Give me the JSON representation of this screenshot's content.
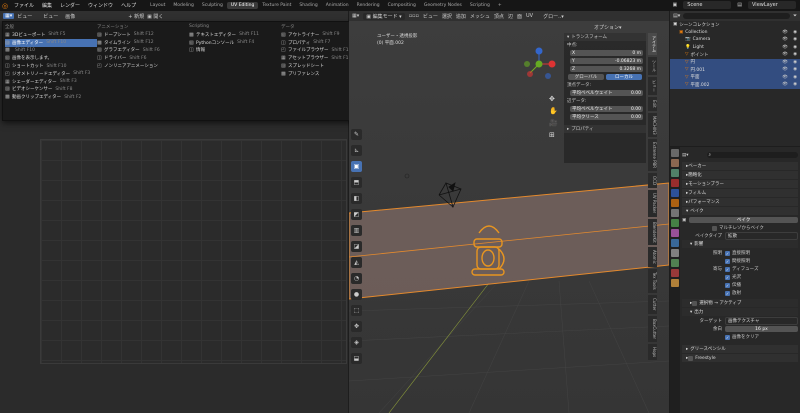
{
  "app": {
    "menus": [
      "ファイル",
      "編集",
      "レンダー",
      "ウィンドウ",
      "ヘルプ"
    ],
    "workspaces": [
      "Layout",
      "Modeling",
      "Sculpting",
      "UV Editing",
      "Texture Paint",
      "Shading",
      "Animation",
      "Rendering",
      "Compositing",
      "Geometry Nodes",
      "Scripting"
    ],
    "active_workspace": "UV Editing",
    "plus": "+",
    "scene": "Scene",
    "view_layer": "ViewLayer",
    "accent": "#e87d0d",
    "selection_blue": "#4772b3"
  },
  "left_editor": {
    "header_items": [
      "ビュー",
      "ビュー",
      "画像"
    ],
    "sub_header": [
      "新規",
      "開く"
    ]
  },
  "editor_menu": {
    "columns": [
      {
        "title": "全般",
        "items": [
          {
            "label": "3Dビューポート",
            "shortcut": "Shift F5"
          },
          {
            "label": "画像エディター",
            "shortcut": "Shift F10",
            "selected": true
          },
          {
            "label": "",
            "shortcut": "Shift F10"
          },
          {
            "label": "画像を表示します。",
            "shortcut": ""
          },
          {
            "label": "ショートカット",
            "shortcut": "Shift F10"
          },
          {
            "label": "ジオメトリノードエディター",
            "shortcut": "Shift F3"
          },
          {
            "label": "シェーダーエディター",
            "shortcut": "Shift F3"
          },
          {
            "label": "ビデオシーケンサー",
            "shortcut": "Shift F8"
          },
          {
            "label": "動画クリップエディター",
            "shortcut": "Shift F2"
          }
        ]
      },
      {
        "title": "アニメーション",
        "items": [
          {
            "label": "ドープシート",
            "shortcut": "Shift F12"
          },
          {
            "label": "タイムライン",
            "shortcut": "Shift F12"
          },
          {
            "label": "グラフエディター",
            "shortcut": "Shift F6"
          },
          {
            "label": "ドライバー",
            "shortcut": "Shift F6"
          },
          {
            "label": "ノンリニアアニメーション",
            "shortcut": ""
          }
        ]
      },
      {
        "title": "Scripting",
        "items": [
          {
            "label": "テキストエディター",
            "shortcut": "Shift F11"
          },
          {
            "label": "Pythonコンソール",
            "shortcut": "Shift F4"
          },
          {
            "label": "情報",
            "shortcut": ""
          }
        ]
      },
      {
        "title": "データ",
        "items": [
          {
            "label": "アウトライナー",
            "shortcut": "Shift F9"
          },
          {
            "label": "プロパティ",
            "shortcut": "Shift F7"
          },
          {
            "label": "ファイルブラウザー",
            "shortcut": "Shift F1"
          },
          {
            "label": "アセットブラウザー",
            "shortcut": "Shift F1"
          },
          {
            "label": "スプレッドシート",
            "shortcut": ""
          },
          {
            "label": "プリファレンス",
            "shortcut": ""
          }
        ]
      }
    ]
  },
  "viewport": {
    "mode": "編集モード",
    "menus": [
      "ビュー",
      "選択",
      "追加",
      "メッシュ",
      "頂点",
      "辺",
      "面",
      "UV"
    ],
    "transform_orientation": "グロー..",
    "options": "オプション",
    "overlay_line1": "ユーザー・透視投影",
    "overlay_line2": "(0) 平面.002",
    "npanel": {
      "title": "トランスフォーム",
      "median_label": "中点:",
      "fields": [
        {
          "axis": "X",
          "value": "0 m"
        },
        {
          "axis": "Y",
          "value": "-0.06823 m"
        },
        {
          "axis": "Z",
          "value": "0.3268 m"
        }
      ],
      "global": "グローバル",
      "local": "ローカル",
      "vertex_data": "頂点データ:",
      "vertex_bevel": "平均ベベルウェイト",
      "vertex_bevel_value": "0.00",
      "edge_data": "辺データ:",
      "edge_bevel": "平均ベベルウェイト",
      "edge_bevel_value": "0.00",
      "crease": "平均クリース",
      "crease_value": "0.00",
      "properties": "プロパティ"
    },
    "side_tabs": [
      "アイテム",
      "ツール",
      "ビュー",
      "Edit",
      "MACHIN3",
      "Extreme PBR",
      "OCD",
      "UV Packer",
      "BlenderKit",
      "Atomic",
      "Tex Tools",
      "Cutter",
      "BoxCutter",
      "Hops"
    ]
  },
  "outliner": {
    "title": "シーンコレクション",
    "rows": [
      {
        "label": "Collection",
        "indent": 1,
        "selected": false
      },
      {
        "label": "Camera",
        "indent": 2,
        "selected": false
      },
      {
        "label": "Light",
        "indent": 2,
        "selected": false
      },
      {
        "label": "ポイント",
        "indent": 2,
        "selected": false
      },
      {
        "label": "円",
        "indent": 2,
        "selected": true
      },
      {
        "label": "円.001",
        "indent": 2,
        "selected": true
      },
      {
        "label": "平面",
        "indent": 2,
        "selected": true
      },
      {
        "label": "平面.002",
        "indent": 2,
        "selected": true
      }
    ]
  },
  "properties": {
    "search_placeholder": "",
    "sections": [
      "ベーカー",
      "簡略化",
      "モーションブラー",
      "フィルム",
      "パフォーマンス"
    ],
    "bake_title": "ベイク",
    "bake_button": "ベイク",
    "multires": "マルチレゾからベイク",
    "bake_type_label": "ベイクタイプ",
    "bake_type_value": "拡散",
    "influence": "影響",
    "contrib_label": "照明",
    "checks": [
      {
        "label": "直接照明",
        "on": true
      },
      {
        "label": "間接照明",
        "on": true
      },
      {
        "label": "ディフューズ",
        "on": true
      },
      {
        "label": "光沢",
        "on": true
      },
      {
        "label": "伝播",
        "on": true
      },
      {
        "label": "放射",
        "on": true
      }
    ],
    "contrib2_label": "寄与",
    "selected_to_active": "選択物 → アクティブ",
    "output": "出力",
    "target_label": "ターゲット",
    "target_value": "画像テクスチャ",
    "margin_label": "余白",
    "margin_value": "16 px",
    "clear_image": "画像をクリア",
    "grease_pencil": "グリースペンシル",
    "freestyle": "Freestyle"
  }
}
